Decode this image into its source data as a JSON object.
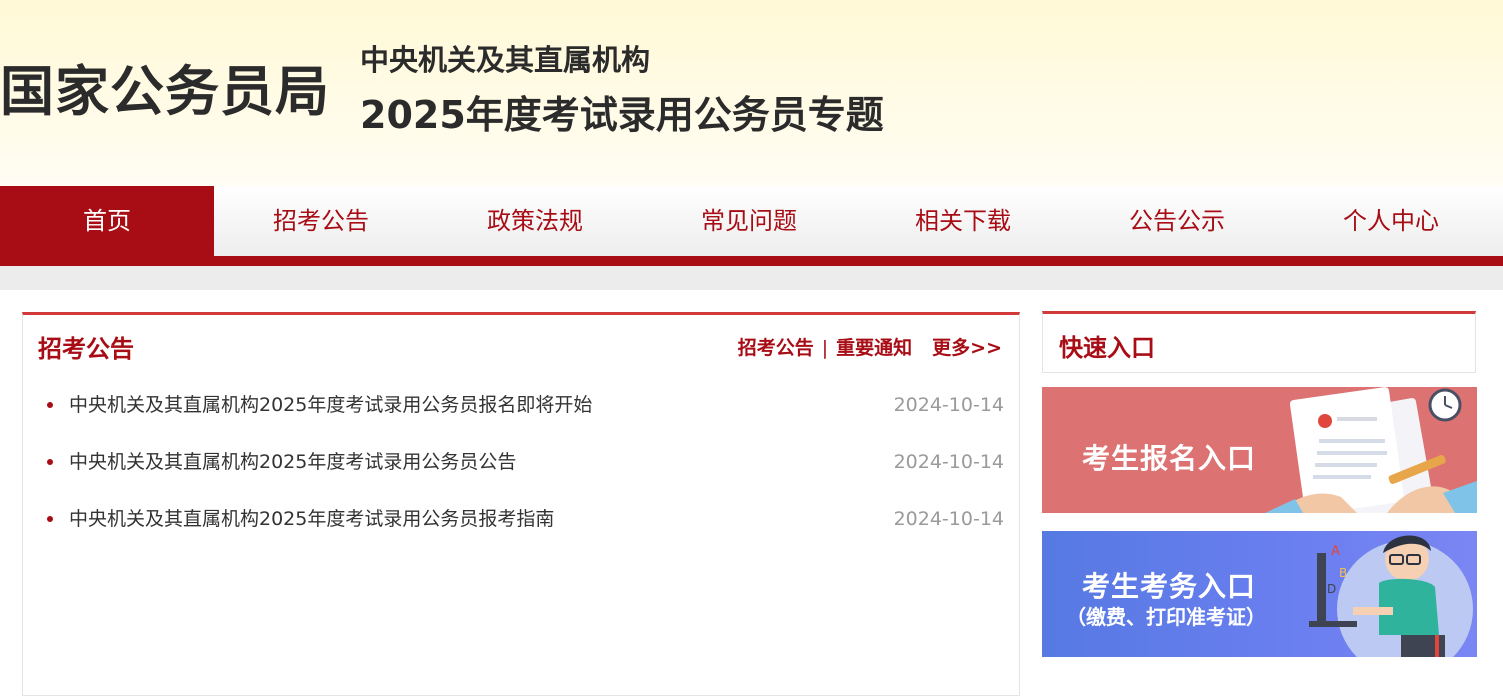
{
  "header": {
    "logo": "国家公务员局",
    "subtitle": "中央机关及其直属机构",
    "title": "2025年度考试录用公务员专题"
  },
  "nav": {
    "items": [
      {
        "label": "首页",
        "active": true
      },
      {
        "label": "招考公告",
        "active": false
      },
      {
        "label": "政策法规",
        "active": false
      },
      {
        "label": "常见问题",
        "active": false
      },
      {
        "label": "相关下载",
        "active": false
      },
      {
        "label": "公告公示",
        "active": false
      },
      {
        "label": "个人中心",
        "active": false
      }
    ],
    "accent_color": "#a80d16"
  },
  "news": {
    "title": "招考公告",
    "links": {
      "recruit": "招考公告",
      "separator": "|",
      "notice": "重要通知",
      "more": "更多>>"
    },
    "items": [
      {
        "title": "中央机关及其直属机构2025年度考试录用公务员报名即将开始",
        "date": "2024-10-14"
      },
      {
        "title": "中央机关及其直属机构2025年度考试录用公务员公告",
        "date": "2024-10-14"
      },
      {
        "title": "中央机关及其直属机构2025年度考试录用公务员报考指南",
        "date": "2024-10-14"
      }
    ]
  },
  "quick": {
    "title": "快速入口",
    "banners": [
      {
        "label": "考生报名入口",
        "icon": "registration-document-illustration",
        "color": "#dd7273"
      },
      {
        "label": "考生考务入口",
        "sublabel": "（缴费、打印准考证）",
        "icon": "student-at-computer-illustration",
        "color": "#5b7be6"
      }
    ]
  }
}
